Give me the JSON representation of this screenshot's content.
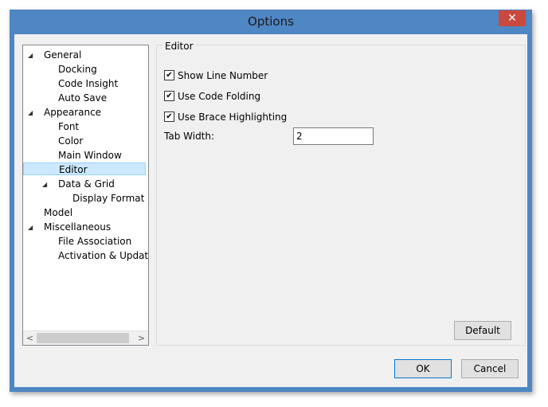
{
  "window": {
    "title": "Options",
    "close_glyph": "✕"
  },
  "tree": {
    "items": [
      {
        "label": "General",
        "expander": "◢"
      },
      {
        "label": "Docking"
      },
      {
        "label": "Code Insight"
      },
      {
        "label": "Auto Save"
      },
      {
        "label": "Appearance",
        "expander": "◢"
      },
      {
        "label": "Font"
      },
      {
        "label": "Color"
      },
      {
        "label": "Main Window"
      },
      {
        "label": "Editor",
        "selected": true
      },
      {
        "label": "Data & Grid",
        "expander": "◢"
      },
      {
        "label": "Display Format"
      },
      {
        "label": "Model"
      },
      {
        "label": "Miscellaneous",
        "expander": "◢"
      },
      {
        "label": "File Association"
      },
      {
        "label": "Activation & Updater"
      }
    ],
    "scroll_left": "<",
    "scroll_right": ">"
  },
  "editor": {
    "group_label": "Editor",
    "show_line_number": {
      "label": "Show Line Number",
      "checked": true
    },
    "use_code_folding": {
      "label": "Use Code Folding",
      "checked": true
    },
    "use_brace_highlighting": {
      "label": "Use Brace Highlighting",
      "checked": true
    },
    "tab_width": {
      "label": "Tab Width:",
      "value": "2"
    },
    "check_glyph": "✔"
  },
  "buttons": {
    "default": "Default",
    "ok": "OK",
    "cancel": "Cancel"
  },
  "colors": {
    "title_bar": "#4f86c4",
    "close": "#c9493c",
    "selection": "#cce8ff"
  }
}
